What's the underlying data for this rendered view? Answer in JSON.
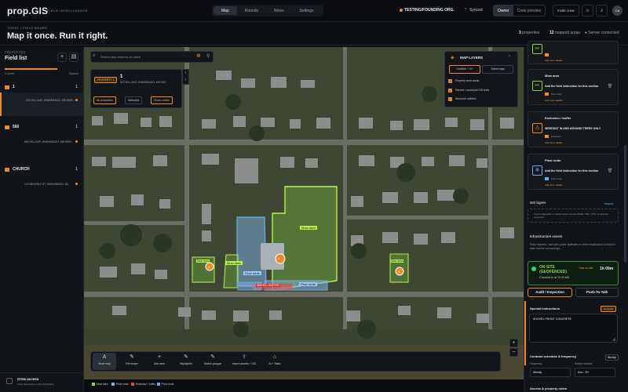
{
  "app": {
    "logo": "prop.GIS",
    "subtitle": "FIELD INTELLIGENCE"
  },
  "nav": {
    "tabs": [
      "Map",
      "Rounds",
      "News",
      "Settings"
    ],
    "active": "Map"
  },
  "header": {
    "org": "TESTING/FOUNDING ORG.",
    "sync_status": "Synced",
    "roles": [
      "Owner",
      "Crew preview"
    ],
    "active_role": "Owner",
    "invite_label": "Invite crew",
    "avatar_initials": "CA",
    "kicker": "TODAY • FIELD BOARD",
    "title": "Map it once. Run it right.",
    "stats": [
      {
        "value": "3",
        "label": "properties"
      },
      {
        "value": "12",
        "label": "mapped areas"
      },
      {
        "value": "",
        "label": "Server connected"
      }
    ]
  },
  "left_panel": {
    "kicker": "PROPERTIES",
    "title": "Field list",
    "meta_left": "3 saved",
    "meta_right": "Synced",
    "groups": [
      {
        "name": "1",
        "count": "1",
        "properties": [
          {
            "address": "320 HILL AVE, WINNEBAGO, MN 5609..."
          }
        ]
      },
      {
        "name": "560",
        "count": "1",
        "properties": [
          {
            "address": "560 HILL AVE, WINNEBAGO, MN 5609..."
          }
        ]
      },
      {
        "name": "CHURCH",
        "count": "1",
        "properties": [
          {
            "address": "120 BEVERLY ST, WINNEBAGO, MI..."
          }
        ]
      }
    ],
    "crew": {
      "title": "Crew access",
      "subtitle": "Invite field teams to this workspace"
    }
  },
  "map": {
    "search_placeholder": "Search any address or place",
    "property_card": {
      "tag": "PROPERTY 1",
      "number": "1",
      "address": "320 HILL AVE, WINNEBAGO, MN 560...",
      "chips": [
        "All properties",
        "Selected",
        "Show routes"
      ]
    },
    "layers": {
      "title": "MAP LAYERS",
      "segments": [
        "Satellite + HT",
        "Street map"
      ],
      "checks": [
        "Property work areas",
        "Parcels / municipal GIS lines",
        "Structure outlines"
      ]
    },
    "areas": [
      {
        "label": "Mow area",
        "kind": "mow"
      },
      {
        "label": "Plow route",
        "kind": "plow"
      },
      {
        "label": "Plow route",
        "kind": "plow"
      },
      {
        "label": "Mow area",
        "kind": "mow"
      },
      {
        "label": "Mow area",
        "kind": "mow"
      },
      {
        "label": "Mow area",
        "kind": "mow"
      },
      {
        "label": "WEEDS / BUFFER",
        "kind": "exclusion"
      }
    ],
    "pins": [
      "1",
      "1",
      "1",
      "1"
    ],
    "tools": [
      {
        "label": "Move map",
        "icon": "A"
      },
      {
        "label": "Edit shape",
        "icon": "✎"
      },
      {
        "label": "Add area",
        "icon": "+"
      },
      {
        "label": "Highlighter",
        "icon": "✎"
      },
      {
        "label": "Sketch polygon",
        "icon": "✎"
      },
      {
        "label": "Import parcels + GIS",
        "icon": "⇪"
      },
      {
        "label": "AI + Tasks",
        "icon": "⌂"
      }
    ],
    "legend": [
      {
        "label": "Mow area",
        "color": "#8fd14f"
      },
      {
        "label": "Plow route",
        "color": "#7fb3e6"
      },
      {
        "label": "Exclusion / buffer",
        "color": "#e04a4a"
      },
      {
        "label": "Plow route",
        "color": "#6aaaf0"
      }
    ]
  },
  "right_panel": {
    "cards": [
      {
        "title": "",
        "instruction": "",
        "swatch": "#f08a24",
        "swatch_label": "",
        "link": "Add more details",
        "icon": "✂",
        "color": "#8fd14f"
      },
      {
        "title": "Mow area",
        "instruction": "Add the field instruction for this section",
        "swatch": "#f08a24",
        "swatch_label": "Mow area",
        "link": "Add more details",
        "icon": "✂",
        "color": "#8fd14f"
      },
      {
        "title": "Exclusion / buffer",
        "instruction": "WEEDEAT IN AND AROUND TREES ONLY",
        "swatch": "#f08a24",
        "swatch_label": "Exclusion",
        "link": "Add more details",
        "icon": "⚠",
        "color": "#f08a24"
      },
      {
        "title": "Plow route",
        "instruction": "Add the field instruction for this section",
        "swatch": "#6aaaf0",
        "swatch_label": "Plow route",
        "link": "Add more details",
        "icon": "❄",
        "color": "#6aaaf0"
      }
    ],
    "gis": {
      "title": "GIS layers",
      "import": "Import",
      "box_text": "Import shapefiles or infrastructure as GeoJSON, KML, GPX, or a/points sequence."
    },
    "infra": {
      "title": "Infrastructure assets",
      "sub": "Place hydrants, manholes, poles, sidewalks or other infrastructure to help the team monitor surroundings."
    },
    "onsite": {
      "title": "ON SITE (GEOFENCED)",
      "subtitle": "Checked in at 10:32 AM",
      "tag": "Time on site",
      "time": "1h 09m"
    },
    "buttons": [
      "Audit / Inspection",
      "Push-To-Talk"
    ],
    "special": {
      "title": "Special instructions",
      "badge": "Required",
      "text": "SHOVEL FRONT CONCRETE"
    },
    "contract": {
      "title": "Contract schedule & frequency",
      "badge": "Weekly",
      "fields": [
        {
          "label": "Frequency",
          "value": "Weekly"
        },
        {
          "label": "Service window",
          "value": "Mon - Fri"
        }
      ]
    },
    "access": {
      "title": "Access & property notes"
    }
  }
}
